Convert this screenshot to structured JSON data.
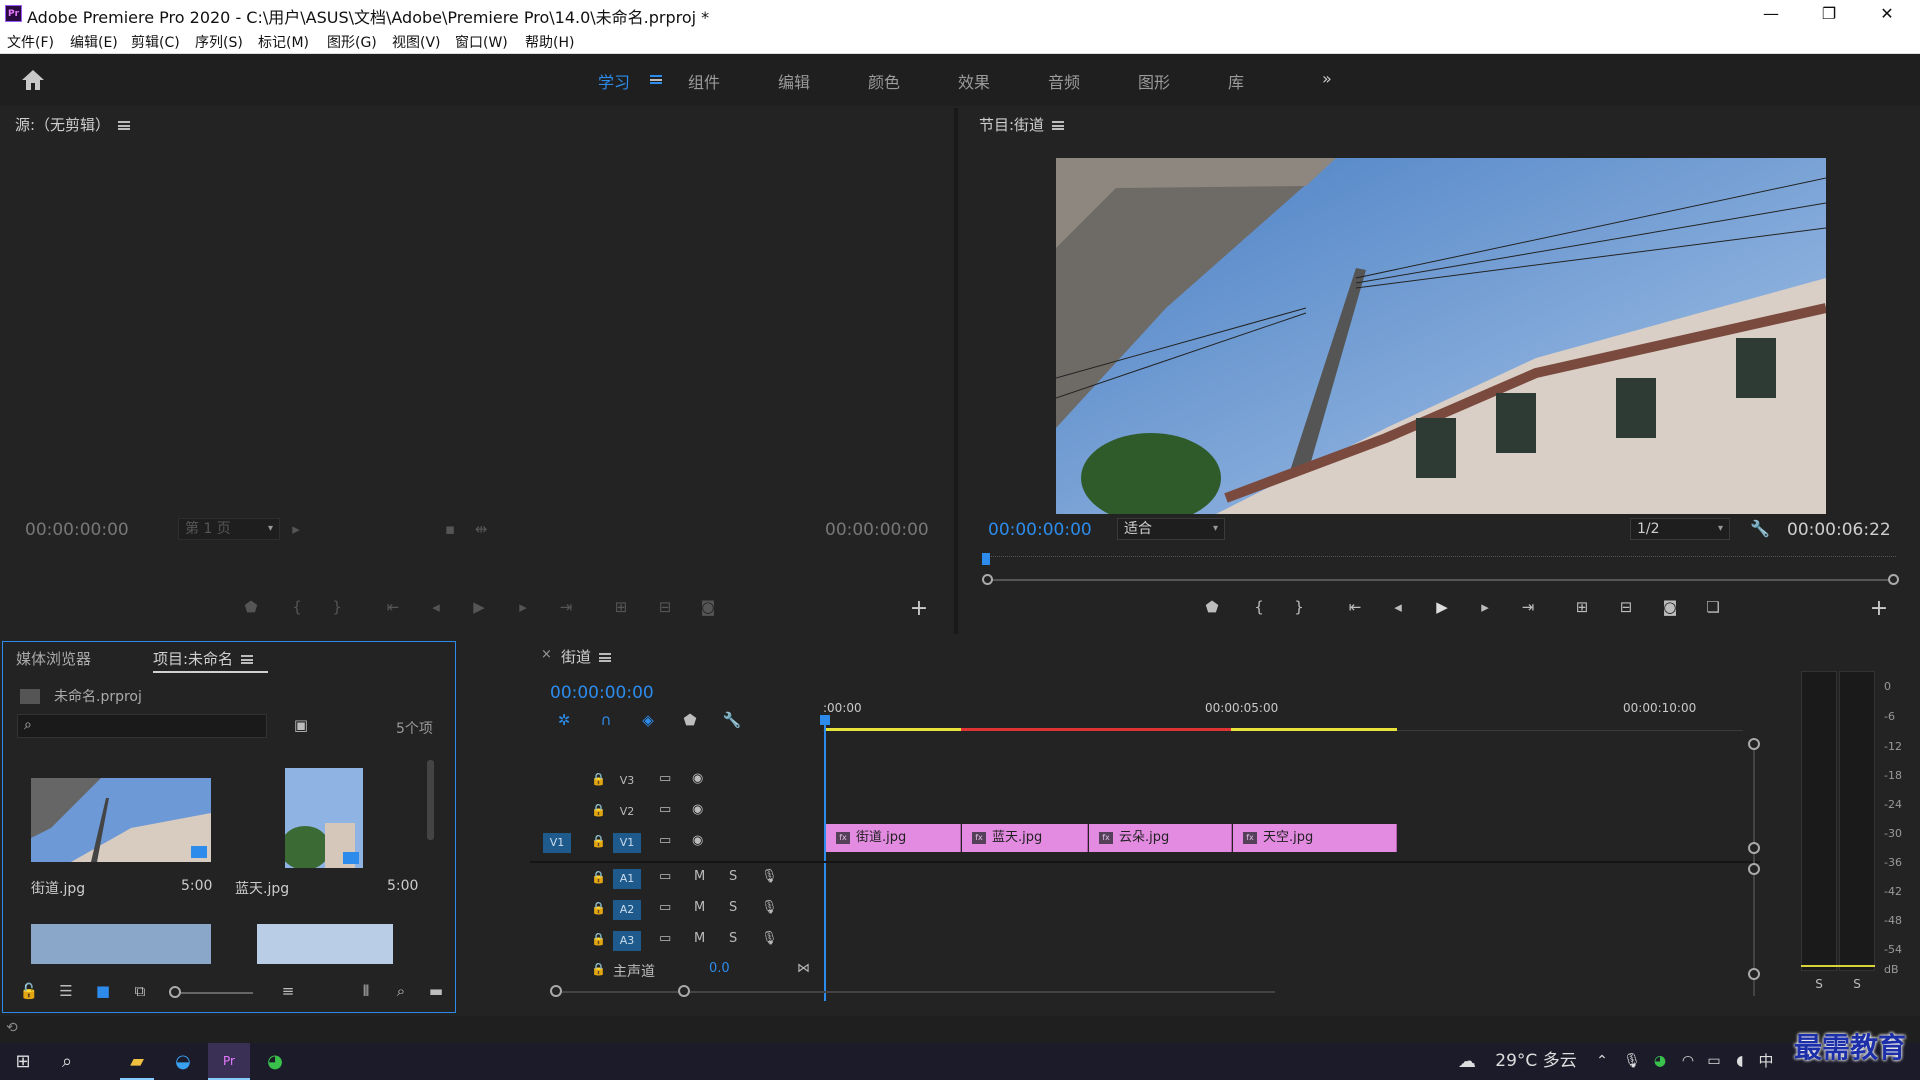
{
  "window": {
    "title": "Adobe Premiere Pro 2020 - C:\\用户\\ASUS\\文档\\Adobe\\Premiere Pro\\14.0\\未命名.prproj *",
    "logo": "Pr"
  },
  "menu": [
    "文件(F)",
    "编辑(E)",
    "剪辑(C)",
    "序列(S)",
    "标记(M)",
    "图形(G)",
    "视图(V)",
    "窗口(W)",
    "帮助(H)"
  ],
  "workspaces": {
    "tabs": [
      "学习",
      "组件",
      "编辑",
      "颜色",
      "效果",
      "音频",
      "图形",
      "库"
    ],
    "active": "学习",
    "more": "»"
  },
  "source": {
    "title": "源:（无剪辑）",
    "tc_left": "00:00:00:00",
    "tc_right": "00:00:00:00",
    "page": "第 1 页"
  },
  "program": {
    "title": "节目:街道",
    "tc_left": "00:00:00:00",
    "tc_right": "00:00:06:22",
    "zoom": "适合",
    "res": "1/2"
  },
  "project": {
    "tab1": "媒体浏览器",
    "tab2": "项目:未命名",
    "file": "未命名.prproj",
    "count": "5个项",
    "items": [
      {
        "name": "街道.jpg",
        "dur": "5:00"
      },
      {
        "name": "蓝天.jpg",
        "dur": "5:00"
      }
    ]
  },
  "timeline": {
    "title": "街道",
    "tc": "00:00:00:00",
    "ruler": [
      ":00:00",
      "00:00:05:00",
      "00:00:10:00"
    ],
    "video_tracks": [
      "V3",
      "V2",
      "V1"
    ],
    "audio_tracks": [
      "A1",
      "A2",
      "A3"
    ],
    "src_patch": "V1",
    "master": "主声道",
    "master_val": "0.0",
    "m": "M",
    "s": "S",
    "clips": [
      "街道.jpg",
      "蓝天.jpg",
      "云朵.jpg",
      "天空.jpg"
    ]
  },
  "meter": {
    "labels": [
      "0",
      "-6",
      "-12",
      "-18",
      "-24",
      "-30",
      "-36",
      "-42",
      "-48",
      "-54",
      "dB"
    ],
    "solo": [
      "S",
      "S"
    ]
  },
  "taskbar": {
    "weather": "29°C 多云",
    "ime": "中",
    "watermark": "最需教育"
  }
}
